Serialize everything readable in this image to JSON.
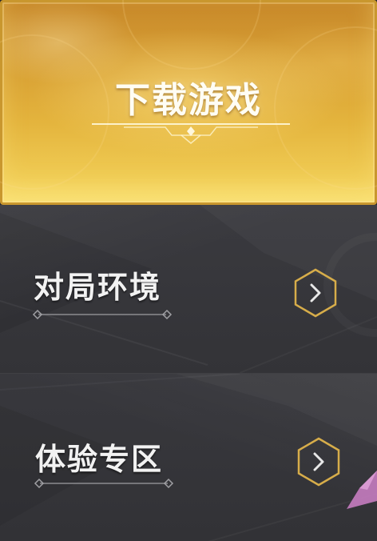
{
  "banner": {
    "title": "下载游戏"
  },
  "menu": {
    "items": [
      {
        "label": "对局环境"
      },
      {
        "label": "体验专区"
      }
    ]
  },
  "colors": {
    "gold_accent": "#d7ad4a",
    "banner_gold": "#e4b43d",
    "row_bg": "#36363a",
    "label_text": "#f2f2f2",
    "corner_accent": "#c57cc0"
  },
  "icons": {
    "row_arrow": "chevron-right-in-hexagon"
  }
}
